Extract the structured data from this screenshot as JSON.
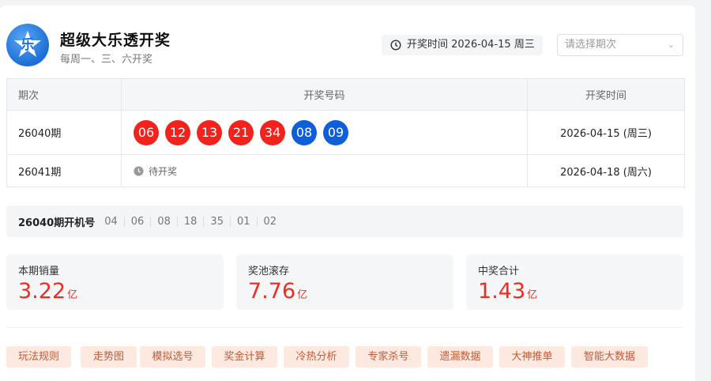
{
  "header": {
    "title": "超级大乐透开奖",
    "subtitle": "每周一、三、六开奖",
    "logo_char": "乐",
    "draw_time_label": "开奖时间 2026-04-15 周三",
    "period_select_placeholder": "请选择期次"
  },
  "table": {
    "headers": [
      "期次",
      "开奖号码",
      "开奖时间"
    ],
    "rows": [
      {
        "period": "26040期",
        "red_balls": [
          "06",
          "12",
          "13",
          "21",
          "34"
        ],
        "blue_balls": [
          "08",
          "09"
        ],
        "date": "2026-04-15 (周三)"
      },
      {
        "period": "26041期",
        "status": "待开奖",
        "date": "2026-04-18 (周六)"
      }
    ]
  },
  "sequence": {
    "label": "26040期开机号",
    "numbers": [
      "04",
      "06",
      "08",
      "18",
      "35",
      "01",
      "02"
    ]
  },
  "stats": [
    {
      "label": "本期销量",
      "value": "3.22",
      "unit": "亿"
    },
    {
      "label": "奖池滚存",
      "value": "7.76",
      "unit": "亿"
    },
    {
      "label": "中奖合计",
      "value": "1.43",
      "unit": "亿"
    }
  ],
  "tools": [
    "玩法规则",
    "走势图",
    "模拟选号",
    "奖金计算",
    "冷热分析",
    "专家杀号",
    "遗漏数据",
    "大神推单",
    "智能大数据"
  ],
  "colors": {
    "red_ball": "#f3221c",
    "blue_ball": "#0e5fd8",
    "accent_value": "#ef2b22",
    "tag_bg": "#fde9df",
    "tag_text": "#c25a36"
  }
}
